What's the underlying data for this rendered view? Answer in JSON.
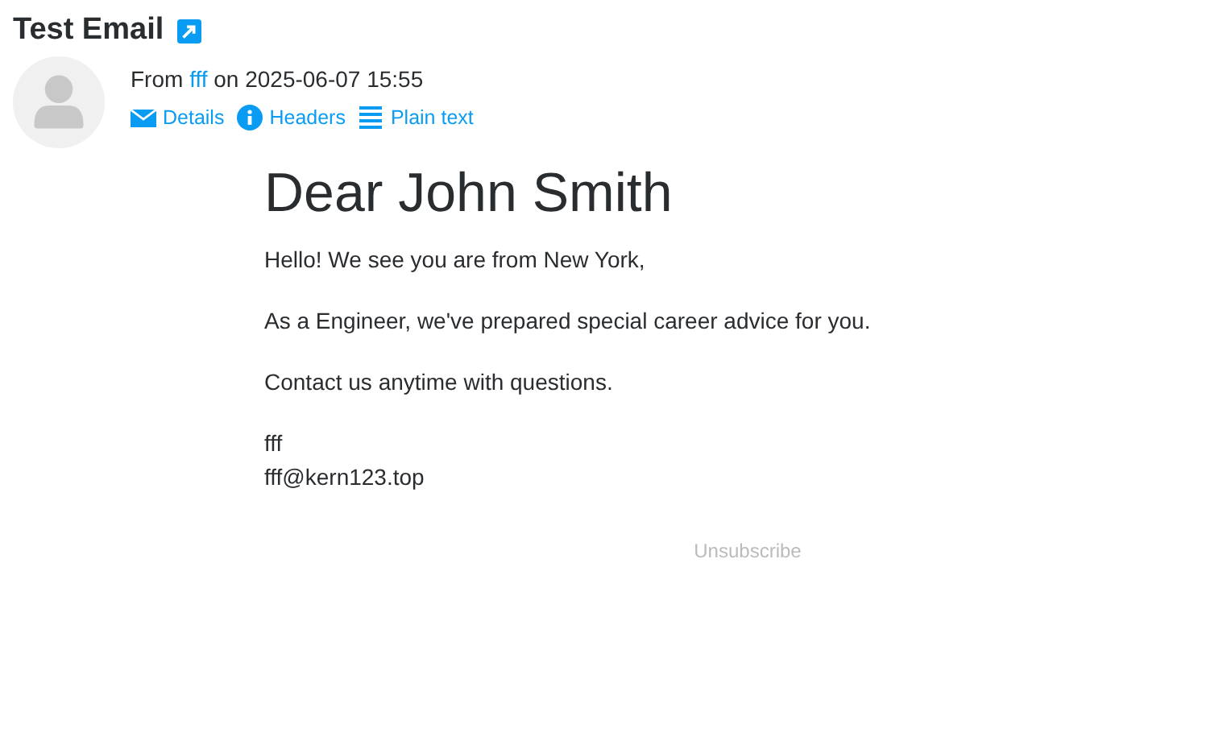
{
  "title": "Test Email",
  "meta": {
    "from_label": "From",
    "sender": "fff",
    "date_text": "on 2025-06-07 15:55"
  },
  "actions": [
    {
      "kind": "envelope",
      "label": "Details"
    },
    {
      "kind": "info",
      "label": "Headers"
    },
    {
      "kind": "lines",
      "label": "Plain text"
    }
  ],
  "body": {
    "heading": "Dear John Smith",
    "paragraphs": [
      "Hello! We see you are from New York,",
      "As a Engineer, we've prepared special career advice for you.",
      "Contact us anytime with questions."
    ],
    "signature": [
      "fff",
      "fff@kern123.top"
    ],
    "unsubscribe": "Unsubscribe"
  }
}
